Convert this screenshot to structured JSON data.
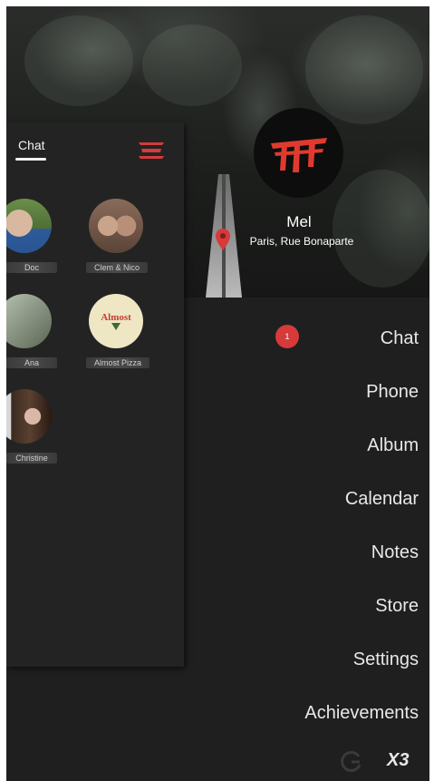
{
  "profile": {
    "name": "Mel",
    "location": "Paris, Rue Bonaparte"
  },
  "menu": {
    "items": [
      "Chat",
      "Phone",
      "Album",
      "Calendar",
      "Notes",
      "Store",
      "Settings",
      "Achievements"
    ],
    "chat_badge": "1"
  },
  "footer": {
    "x_label": "X3"
  },
  "chat_panel": {
    "title": "Chat",
    "contacts": [
      {
        "name": "Doc"
      },
      {
        "name": "Clem & Nico"
      },
      {
        "name": "Ana"
      },
      {
        "name": "Almost Pizza",
        "logo_text": "Almost"
      },
      {
        "name": "Christine"
      }
    ]
  },
  "colors": {
    "accent": "#d63a3a",
    "background": "#1f1f1f",
    "panel": "#232323"
  },
  "icons": [
    "location-pin-icon",
    "hamburger-menu-icon",
    "logo-icon",
    "loading-icon"
  ]
}
